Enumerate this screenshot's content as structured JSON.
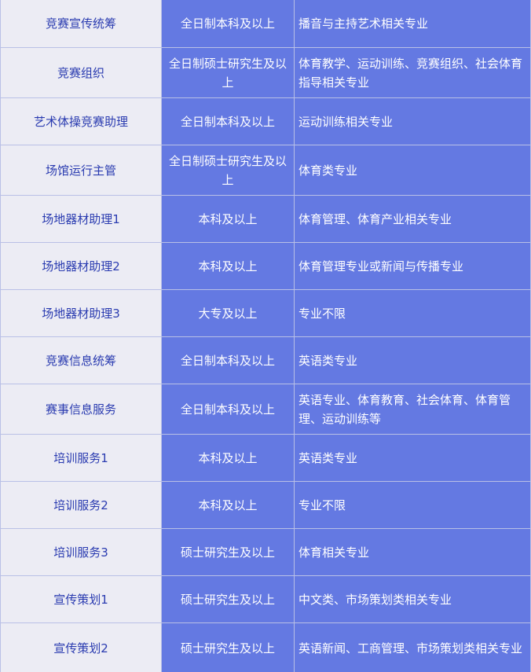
{
  "rows": [
    {
      "position": "竞赛宣传统筹",
      "education": "全日制本科及以上",
      "major": "播音与主持艺术相关专业"
    },
    {
      "position": "竞赛组织",
      "education": "全日制硕士研究生及以上",
      "major": "体育教学、运动训练、竞赛组织、社会体育指导相关专业"
    },
    {
      "position": "艺术体操竞赛助理",
      "education": "全日制本科及以上",
      "major": "运动训练相关专业"
    },
    {
      "position": "场馆运行主管",
      "education": "全日制硕士研究生及以上",
      "major": "体育类专业"
    },
    {
      "position": "场地器材助理1",
      "education": "本科及以上",
      "major": "体育管理、体育产业相关专业"
    },
    {
      "position": "场地器材助理2",
      "education": "本科及以上",
      "major": "体育管理专业或新闻与传播专业"
    },
    {
      "position": "场地器材助理3",
      "education": "大专及以上",
      "major": "专业不限"
    },
    {
      "position": "竞赛信息统筹",
      "education": "全日制本科及以上",
      "major": "英语类专业"
    },
    {
      "position": "赛事信息服务",
      "education": "全日制本科及以上",
      "major": "英语专业、体育教育、社会体育、体育管理、运动训练等"
    },
    {
      "position": "培训服务1",
      "education": "本科及以上",
      "major": "英语类专业"
    },
    {
      "position": "培训服务2",
      "education": "本科及以上",
      "major": "专业不限"
    },
    {
      "position": "培训服务3",
      "education": "硕士研究生及以上",
      "major": "体育相关专业"
    },
    {
      "position": "宣传策划1",
      "education": "硕士研究生及以上",
      "major": "中文类、市场策划类相关专业"
    },
    {
      "position": "宣传策划2",
      "education": "硕士研究生及以上",
      "major": "英语新闻、工商管理、市场策划类相关专业"
    }
  ]
}
